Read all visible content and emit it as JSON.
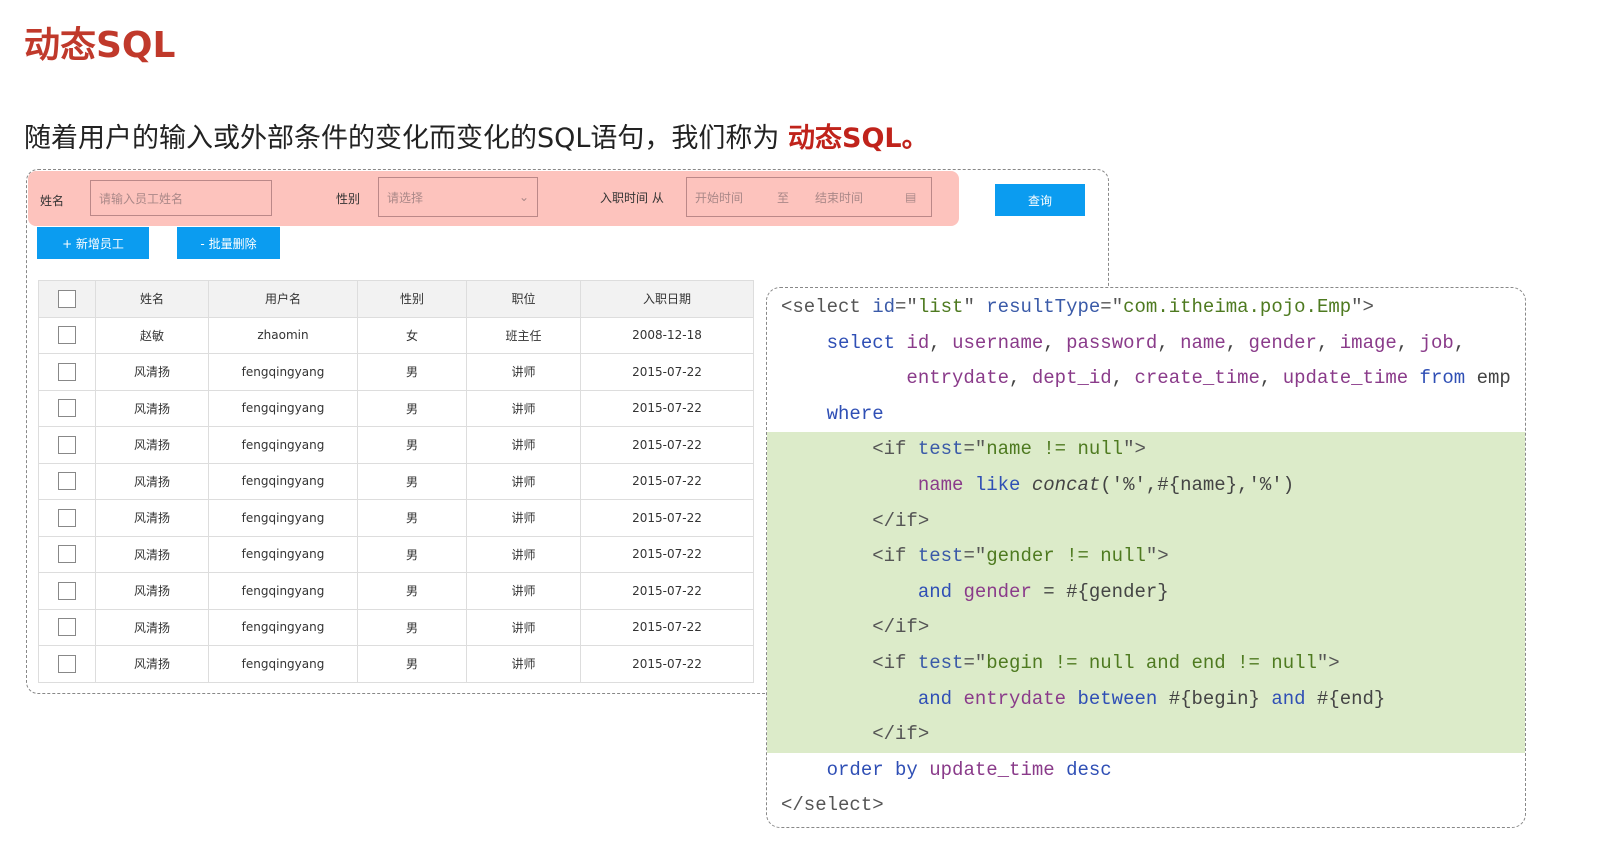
{
  "title": "动态SQL",
  "subtitle": {
    "text": "随着用户的输入或外部条件的变化而变化的SQL语句，我们称为 ",
    "highlight": "动态SQL。"
  },
  "filter": {
    "name_label": "姓名",
    "name_placeholder": "请输入员工姓名",
    "gender_label": "性别",
    "gender_placeholder": "请选择",
    "date_label": "入职时间 从",
    "start_placeholder": "开始时间",
    "to": "至",
    "end_placeholder": "结束时间",
    "query_button": "查询"
  },
  "actions": {
    "add": "+ 新增员工",
    "batch_delete": "- 批量删除"
  },
  "table": {
    "headers": [
      "姓名",
      "用户名",
      "性别",
      "职位",
      "入职日期"
    ],
    "rows": [
      [
        "赵敏",
        "zhaomin",
        "女",
        "班主任",
        "2008-12-18"
      ],
      [
        "风清扬",
        "fengqingyang",
        "男",
        "讲师",
        "2015-07-22"
      ],
      [
        "风清扬",
        "fengqingyang",
        "男",
        "讲师",
        "2015-07-22"
      ],
      [
        "风清扬",
        "fengqingyang",
        "男",
        "讲师",
        "2015-07-22"
      ],
      [
        "风清扬",
        "fengqingyang",
        "男",
        "讲师",
        "2015-07-22"
      ],
      [
        "风清扬",
        "fengqingyang",
        "男",
        "讲师",
        "2015-07-22"
      ],
      [
        "风清扬",
        "fengqingyang",
        "男",
        "讲师",
        "2015-07-22"
      ],
      [
        "风清扬",
        "fengqingyang",
        "男",
        "讲师",
        "2015-07-22"
      ],
      [
        "风清扬",
        "fengqingyang",
        "男",
        "讲师",
        "2015-07-22"
      ],
      [
        "风清扬",
        "fengqingyang",
        "男",
        "讲师",
        "2015-07-22"
      ]
    ]
  },
  "colors": {
    "accent": "#c0231b",
    "button": "#0b9cf0",
    "filter_bg": "#fdc3bd",
    "highlight_bg": "#dcebc9"
  },
  "code": [
    {
      "indent": 0,
      "tokens": [
        [
          "tag",
          "<select "
        ],
        [
          "attr",
          "id"
        ],
        [
          "tag",
          "=\""
        ],
        [
          "str",
          "list"
        ],
        [
          "tag",
          "\" "
        ],
        [
          "attr",
          "resultType"
        ],
        [
          "tag",
          "=\""
        ],
        [
          "str",
          "com.itheima.pojo.Emp"
        ],
        [
          "tag",
          "\">"
        ]
      ]
    },
    {
      "indent": 4,
      "tokens": [
        [
          "kw",
          "select "
        ],
        [
          "col",
          "id"
        ],
        [
          "plain",
          ", "
        ],
        [
          "col",
          "username"
        ],
        [
          "plain",
          ", "
        ],
        [
          "col",
          "password"
        ],
        [
          "plain",
          ", "
        ],
        [
          "col",
          "name"
        ],
        [
          "plain",
          ", "
        ],
        [
          "col",
          "gender"
        ],
        [
          "plain",
          ", "
        ],
        [
          "col",
          "image"
        ],
        [
          "plain",
          ", "
        ],
        [
          "col",
          "job"
        ],
        [
          "plain",
          ","
        ]
      ]
    },
    {
      "indent": 11,
      "tokens": [
        [
          "col",
          "entrydate"
        ],
        [
          "plain",
          ", "
        ],
        [
          "col",
          "dept_id"
        ],
        [
          "plain",
          ", "
        ],
        [
          "col",
          "create_time"
        ],
        [
          "plain",
          ", "
        ],
        [
          "col",
          "update_time"
        ],
        [
          "kw",
          " from "
        ],
        [
          "plain",
          "emp"
        ]
      ]
    },
    {
      "indent": 4,
      "tokens": [
        [
          "kw",
          "where"
        ]
      ]
    },
    {
      "indent": 8,
      "tokens": [
        [
          "tag",
          "<if "
        ],
        [
          "attr",
          "test"
        ],
        [
          "tag",
          "=\""
        ],
        [
          "str",
          "name != null"
        ],
        [
          "tag",
          "\">"
        ]
      ]
    },
    {
      "indent": 12,
      "tokens": [
        [
          "col",
          "name "
        ],
        [
          "kw",
          "like "
        ],
        [
          "fn",
          "concat"
        ],
        [
          "plain",
          "('%',#{name},'%')"
        ]
      ]
    },
    {
      "indent": 8,
      "tokens": [
        [
          "tag",
          "</if>"
        ]
      ]
    },
    {
      "indent": 8,
      "tokens": [
        [
          "tag",
          "<if "
        ],
        [
          "attr",
          "test"
        ],
        [
          "tag",
          "=\""
        ],
        [
          "str",
          "gender != null"
        ],
        [
          "tag",
          "\">"
        ]
      ]
    },
    {
      "indent": 12,
      "tokens": [
        [
          "kw",
          "and "
        ],
        [
          "col",
          "gender "
        ],
        [
          "plain",
          "= #{gender}"
        ]
      ]
    },
    {
      "indent": 8,
      "tokens": [
        [
          "tag",
          "</if>"
        ]
      ]
    },
    {
      "indent": 8,
      "tokens": [
        [
          "tag",
          "<if "
        ],
        [
          "attr",
          "test"
        ],
        [
          "tag",
          "=\""
        ],
        [
          "str",
          "begin != null and end != null"
        ],
        [
          "tag",
          "\">"
        ]
      ]
    },
    {
      "indent": 12,
      "tokens": [
        [
          "kw",
          "and "
        ],
        [
          "col",
          "entrydate "
        ],
        [
          "kw",
          "between "
        ],
        [
          "plain",
          "#{begin} "
        ],
        [
          "kw",
          "and "
        ],
        [
          "plain",
          "#{end}"
        ]
      ]
    },
    {
      "indent": 8,
      "tokens": [
        [
          "tag",
          "</if>"
        ]
      ]
    },
    {
      "indent": 4,
      "tokens": [
        [
          "kw",
          "order by "
        ],
        [
          "col",
          "update_time "
        ],
        [
          "kw",
          "desc"
        ]
      ]
    },
    {
      "indent": 0,
      "tokens": [
        [
          "tag",
          "</select>"
        ]
      ]
    }
  ]
}
